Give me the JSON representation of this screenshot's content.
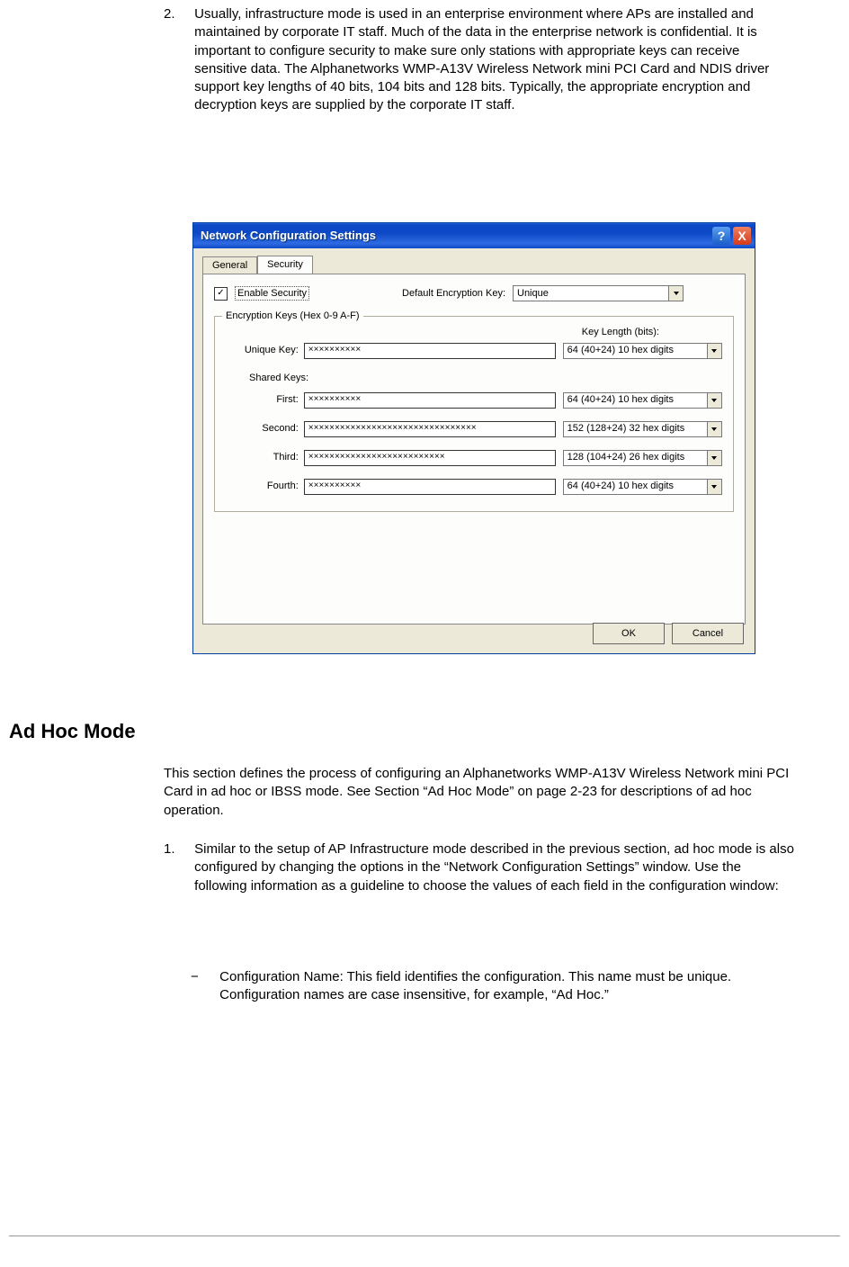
{
  "list2": {
    "num": "2.",
    "body": "Usually, infrastructure mode is used in an enterprise environment where APs are installed and maintained by corporate IT staff. Much of the data in the enterprise network is confidential. It is important to configure security to make sure only stations with appropriate keys can receive sensitive data. The Alphanetworks WMP-A13V Wireless Network mini PCI Card and NDIS driver support key lengths of 40 bits, 104 bits and 128 bits. Typically, the appropriate encryption and decryption keys are supplied by the corporate IT staff."
  },
  "dialog": {
    "title": "Network Configuration Settings",
    "help": "?",
    "close": "X",
    "tabs": {
      "general": "General",
      "security": "Security"
    },
    "enable_security": "Enable Security",
    "enable_checked": "✓",
    "default_enc_label": "Default Encryption Key:",
    "default_enc_value": "Unique",
    "group_title": "Encryption Keys (Hex 0-9 A-F)",
    "key_len_header": "Key Length (bits):",
    "unique_label": "Unique Key:",
    "shared_label": "Shared Keys:",
    "rows": {
      "unique": {
        "value": "××××××××××",
        "len": "64  (40+24)  10 hex digits"
      },
      "first": {
        "label": "First:",
        "value": "××××××××××",
        "len": "64  (40+24)  10 hex digits"
      },
      "second": {
        "label": "Second:",
        "value": "××××××××××××××××××××××××××××××××",
        "len": "152 (128+24) 32 hex digits"
      },
      "third": {
        "label": "Third:",
        "value": "××××××××××××××××××××××××××",
        "len": "128 (104+24) 26 hex digits"
      },
      "fourth": {
        "label": "Fourth:",
        "value": "××××××××××",
        "len": "64  (40+24)  10 hex digits"
      }
    },
    "ok": "OK",
    "cancel": "Cancel"
  },
  "h2": "Ad Hoc Mode",
  "adhoc_intro": "This section defines the process of configuring an Alphanetworks WMP-A13V Wireless Network mini PCI Card in ad hoc or IBSS mode. See Section “Ad Hoc Mode” on page 2-23 for descriptions of ad hoc operation.",
  "list1b": {
    "num": "1.",
    "body": "Similar to the setup of AP Infrastructure mode described in the previous section, ad hoc mode is also configured by changing the options in the “Network Configuration Settings” window. Use the following information as a guideline to choose the values of each field in the configuration window:"
  },
  "dash": {
    "sym": "−",
    "body": "Configuration Name: This field identifies the configuration. This name must be unique. Configuration names are case insensitive, for example, “Ad Hoc.”"
  }
}
